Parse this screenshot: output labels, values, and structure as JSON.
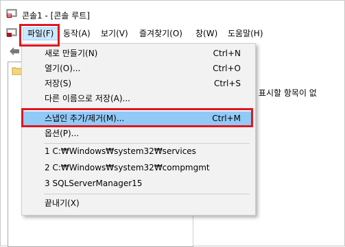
{
  "window": {
    "title": "콘솔1 - [콘솔 루트]"
  },
  "menubar": {
    "items": [
      {
        "label": "파일(F)",
        "open": true
      },
      {
        "label": "동작(A)"
      },
      {
        "label": "보기(V)"
      },
      {
        "label": "즐겨찾기(O)"
      },
      {
        "label": "창(W)"
      },
      {
        "label": "도움말(H)"
      }
    ]
  },
  "right_pane": {
    "text": "기에서 표시할 항목이 없"
  },
  "file_menu": {
    "items": [
      {
        "label": "새로 만들기(N)",
        "shortcut": "Ctrl+N"
      },
      {
        "label": "열기(O)...",
        "shortcut": "Ctrl+O"
      },
      {
        "label": "저장(S)",
        "shortcut": "Ctrl+S"
      },
      {
        "label": "다른 이름으로 저장(A)...",
        "shortcut": ""
      },
      {
        "label": "스냅인 추가/제거(M)...",
        "shortcut": "Ctrl+M",
        "selected": true
      },
      {
        "label": "옵션(P)...",
        "shortcut": ""
      },
      {
        "label": "1 C:₩Windows₩system32₩services",
        "shortcut": ""
      },
      {
        "label": "2 C:₩Windows₩system32₩compmgmt",
        "shortcut": ""
      },
      {
        "label": "3 SQLServerManager15",
        "shortcut": ""
      },
      {
        "label": "끝내기(X)",
        "shortcut": ""
      }
    ]
  },
  "colors": {
    "highlight_box": "#e0161f",
    "selected_item": "#91c9f7",
    "menu_background": "#f2f2f2"
  }
}
